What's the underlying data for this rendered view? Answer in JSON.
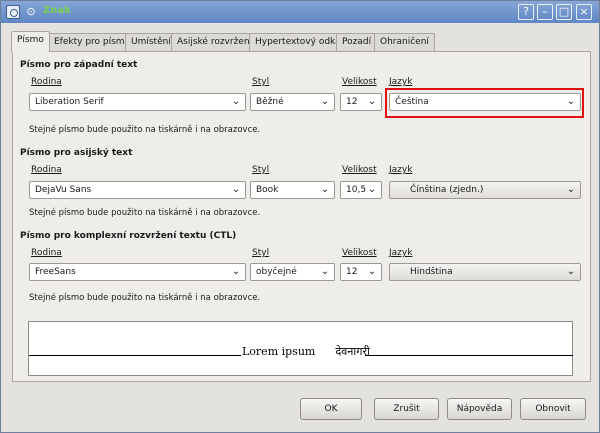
{
  "window": {
    "title": "Znak",
    "controls": [
      "?",
      "–",
      "□",
      "×"
    ]
  },
  "tabs": [
    "Písmo",
    "Efekty pro písmo",
    "Umístění",
    "Asijské rozvržení",
    "Hypertextový odkaz",
    "Pozadí",
    "Ohraničení"
  ],
  "western": {
    "title": "Písmo pro západní text",
    "family_label": "Rodina",
    "style_label": "Styl",
    "size_label": "Velikost",
    "lang_label": "Jazyk",
    "family": "Liberation Serif",
    "style": "Běžné",
    "size": "12",
    "language": "Čeština",
    "info": "Stejné písmo bude použito na tiskárně i na obrazovce."
  },
  "asian": {
    "title": "Písmo pro asijský text",
    "family_label": "Rodina",
    "style_label": "Styl",
    "size_label": "Velikost",
    "lang_label": "Jazyk",
    "family": "DejaVu Sans",
    "style": "Book",
    "size": "10,5",
    "language": "Čínština (zjedn.)",
    "info": "Stejné písmo bude použito na tiskárně i na obrazovce."
  },
  "ctl": {
    "title": "Písmo pro komplexní rozvržení textu (CTL)",
    "family_label": "Rodina",
    "style_label": "Styl",
    "size_label": "Velikost",
    "lang_label": "Jazyk",
    "family": "FreeSans",
    "style": "obyčejné",
    "size": "12",
    "language": "Hindština",
    "info": "Stejné písmo bude použito na tiskárně i na obrazovce."
  },
  "preview": {
    "text": "Lorem ipsum",
    "text_ctl": "देवनागरी"
  },
  "buttons": {
    "ok": "OK",
    "cancel": "Zrušit",
    "help": "Nápověda",
    "reset": "Obnovit"
  },
  "colors": {
    "highlight": "#e01010",
    "title_text": "#7cd04f"
  }
}
